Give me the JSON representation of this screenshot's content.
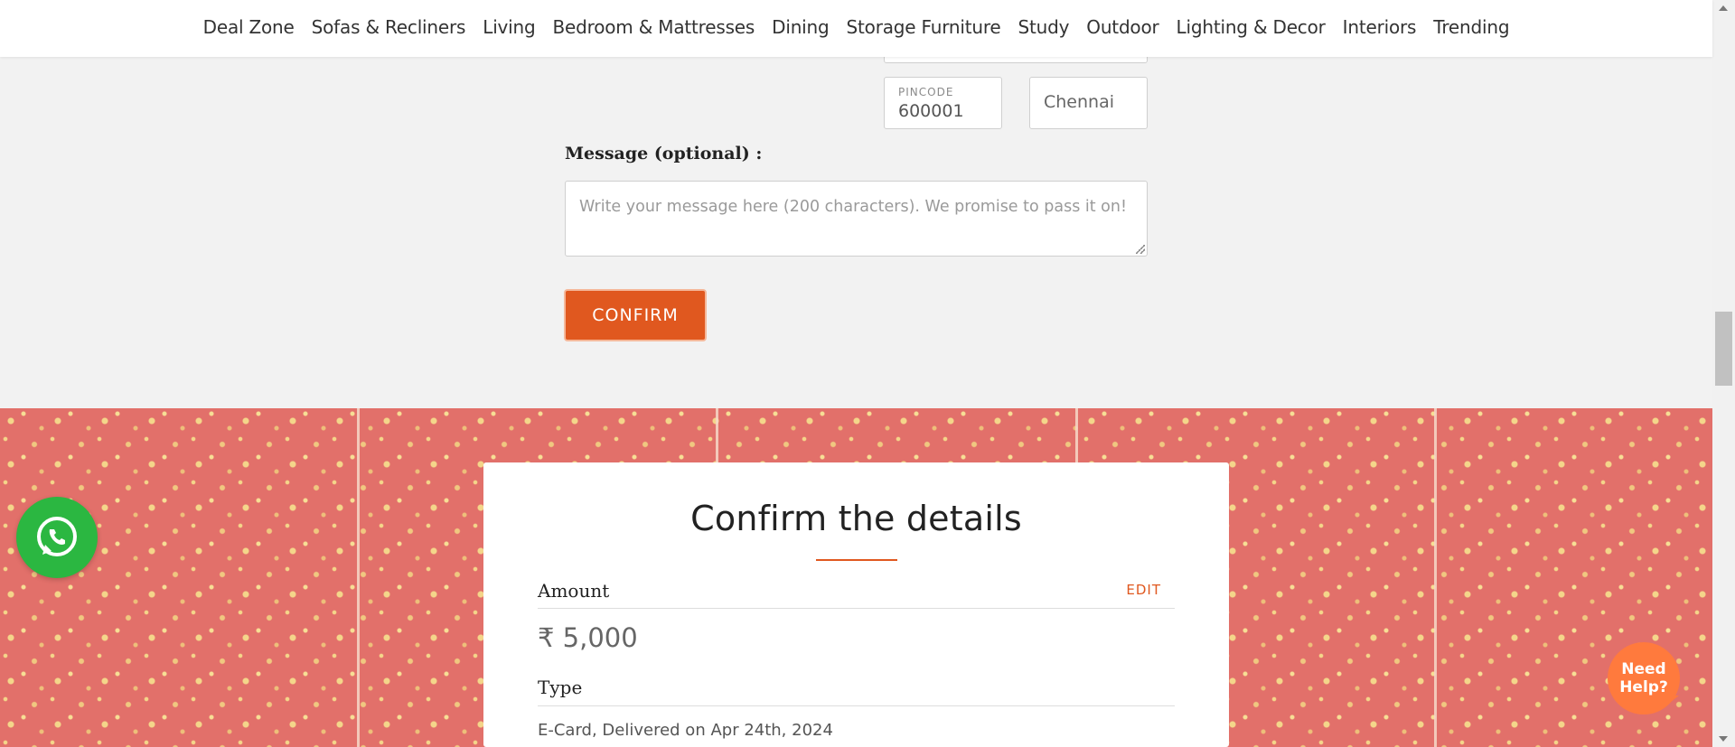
{
  "nav": {
    "items": [
      "Deal Zone",
      "Sofas & Recliners",
      "Living",
      "Bedroom & Mattresses",
      "Dining",
      "Storage Furniture",
      "Study",
      "Outdoor",
      "Lighting & Decor",
      "Interiors",
      "Trending"
    ]
  },
  "form": {
    "pincode_label": "PINCODE",
    "pincode_value": "600001",
    "city_value": "Chennai",
    "message_label": "Message (optional) :",
    "message_placeholder": "Write your message here (200 characters). We promise to pass it on!",
    "confirm_label": "CONFIRM"
  },
  "card": {
    "title": "Confirm the details",
    "amount_label": "Amount",
    "edit_label": "EDIT",
    "amount_value": "₹ 5,000",
    "type_label": "Type",
    "type_value": "E-Card, Delivered on Apr 24th, 2024"
  },
  "help": {
    "label_line1": "Need",
    "label_line2": "Help?"
  },
  "icons": {
    "whatsapp": "whatsapp-icon",
    "accent": "#e0581f",
    "pattern_bg": "#e2706a"
  }
}
